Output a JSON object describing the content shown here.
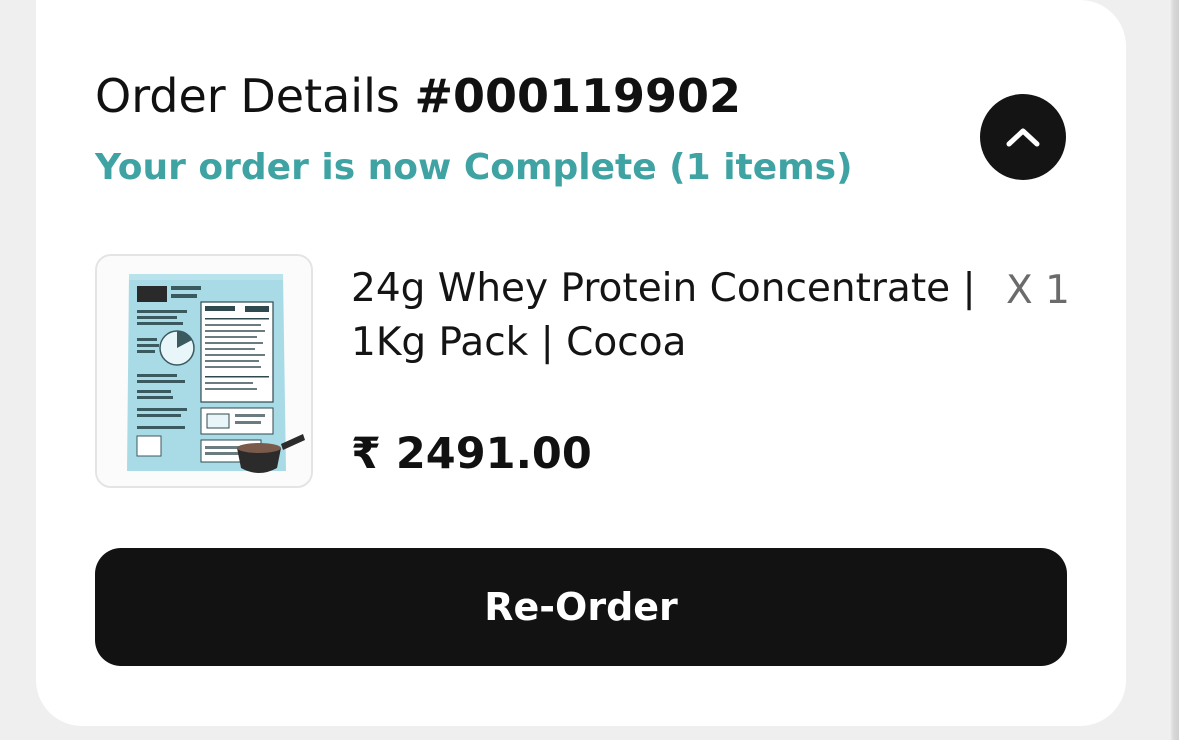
{
  "order": {
    "title_prefix": "Order Details",
    "order_number": "#000119902",
    "status_text": "Your order is now Complete (1 items)"
  },
  "item": {
    "name": "24g Whey Protein Concentrate | 1Kg Pack | Cocoa",
    "quantity": "X 1",
    "price": "₹ 2491.00",
    "image_icon": "protein-pouch-image"
  },
  "actions": {
    "collapse_icon": "chevron-up-icon",
    "reorder_label": "Re-Order"
  },
  "colors": {
    "status_accent": "#3fa3a3",
    "button_bg": "#121212",
    "card_bg": "#ffffff",
    "page_bg": "#efefef"
  }
}
